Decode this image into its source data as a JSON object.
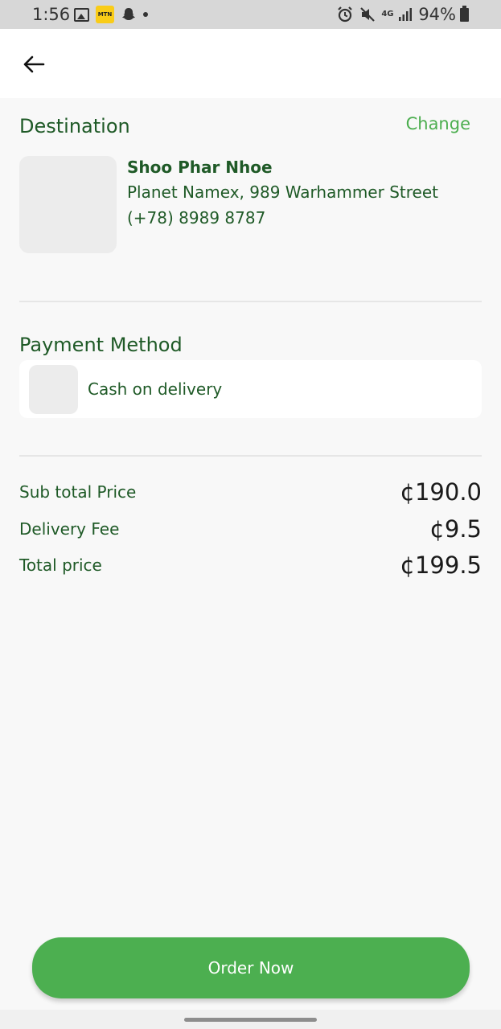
{
  "status_bar": {
    "time": "1:56",
    "mtn_label": "MTN",
    "network": "4G",
    "battery": "94%"
  },
  "destination": {
    "title": "Destination",
    "change_label": "Change",
    "name": "Shoo Phar Nhoe",
    "address": "Planet Namex, 989 Warhammer Street",
    "phone": "(+78) 8989 8787"
  },
  "payment": {
    "title": "Payment Method",
    "method": "Cash on delivery"
  },
  "prices": {
    "subtotal_label": "Sub total Price",
    "subtotal_value": "¢190.0",
    "delivery_label": "Delivery Fee",
    "delivery_value": "¢9.5",
    "total_label": "Total price",
    "total_value": "¢199.5"
  },
  "order_button": "Order Now",
  "colors": {
    "primary": "#4caf50",
    "text_green": "#1f5a27",
    "link_green": "#4cae4f",
    "background": "#f8f8f8"
  }
}
